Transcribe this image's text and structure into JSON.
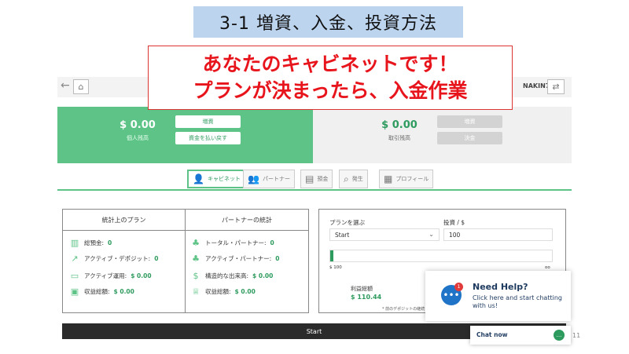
{
  "slide": {
    "title": "3-1  増資、入金、投資方法",
    "callout_line1": "あなたのキャビネットです！",
    "callout_line2": "プランが決まったら、入金作業",
    "page_number": "11"
  },
  "header": {
    "back_icon": "back-arrow-icon",
    "home_icon": "home-icon",
    "user_name": "NAKIN7",
    "exit_icon": "exit-icon"
  },
  "balances": {
    "personal_amount": "$ 0.00",
    "personal_label": "個人残高",
    "deposit_button": "増資",
    "withdraw_button": "資金を払い戻す",
    "trading_amount": "$ 0.00",
    "trading_label": "取引残高",
    "trading_deposit_button": "増資",
    "trading_settle_button": "決金"
  },
  "tabs": [
    {
      "label": "キャビネット",
      "icon": "user-icon"
    },
    {
      "label": "パートナー",
      "icon": "partners-icon"
    },
    {
      "label": "預金",
      "icon": "deposit-icon"
    },
    {
      "label": "発生",
      "icon": "search-icon"
    },
    {
      "label": "プロフィール",
      "icon": "profile-icon"
    }
  ],
  "stats": {
    "left_title": "統計上のプラン",
    "right_title": "パートナーの統計",
    "left": [
      {
        "label": "総預金:",
        "value": "0",
        "icon": "bar-chart-icon"
      },
      {
        "label": "アクティブ・デポジット:",
        "value": "0",
        "icon": "trend-icon"
      },
      {
        "label": "アクティブ運用:",
        "value": "$ 0.00",
        "icon": "cash-icon"
      },
      {
        "label": "収益総額:",
        "value": "$ 0.00",
        "icon": "safe-icon"
      }
    ],
    "right": [
      {
        "label": "トータル・パートナー:",
        "value": "0",
        "icon": "people-icon"
      },
      {
        "label": "アクティブ・パートナー:",
        "value": "0",
        "icon": "people-active-icon"
      },
      {
        "label": "構造的な出来高:",
        "value": "$ 0.00",
        "icon": "money-bag-icon"
      },
      {
        "label": "収益総額:",
        "value": "$ 0.00",
        "icon": "trophy-icon"
      }
    ]
  },
  "plan": {
    "select_label": "プランを選ぶ",
    "select_value": "Start",
    "invest_label": "投資 / $",
    "invest_value": "100",
    "slider_min": "$ 100",
    "slider_max": "oo",
    "slider_fraction": 0.01,
    "total_label": "利益総額",
    "total_value": "$ 110.44",
    "deposit_note": "* 前のデポジットの継続"
  },
  "plan_bar": "Start",
  "help": {
    "badge": "1",
    "title": "Need Help?",
    "text": "Click here and start chatting with us!"
  },
  "chat": {
    "label": "Chat now"
  }
}
